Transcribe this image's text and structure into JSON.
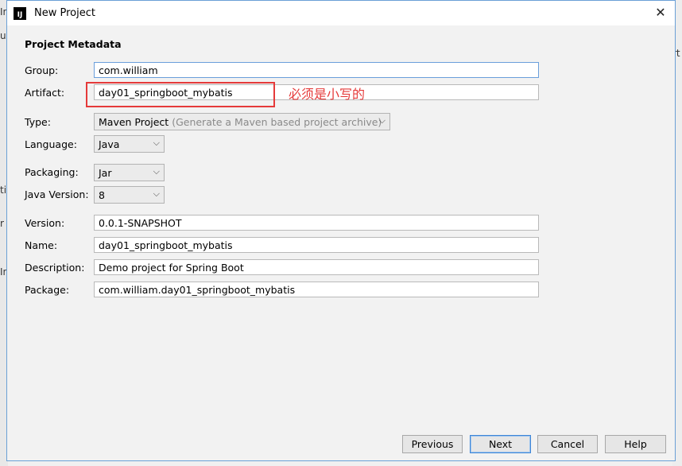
{
  "window": {
    "title": "New Project",
    "app_icon_text": "IJ"
  },
  "background_fragments": {
    "left_top": "In",
    "left_mid": "ur",
    "left_t": "ti",
    "left_r": "r",
    "left_i": "In",
    "right_t": "rt"
  },
  "form": {
    "section_title": "Project Metadata",
    "group": {
      "label": "Group:",
      "value": "com.william"
    },
    "artifact": {
      "label": "Artifact:",
      "value": "day01_springboot_mybatis"
    },
    "type": {
      "label": "Type:",
      "value": "Maven Project",
      "hint": "(Generate a Maven based project archive)"
    },
    "language": {
      "label": "Language:",
      "value": "Java"
    },
    "packaging": {
      "label": "Packaging:",
      "value": "Jar"
    },
    "java_version": {
      "label": "Java Version:",
      "value": "8"
    },
    "version": {
      "label": "Version:",
      "value": "0.0.1-SNAPSHOT"
    },
    "name": {
      "label": "Name:",
      "value": "day01_springboot_mybatis"
    },
    "description": {
      "label": "Description:",
      "value": "Demo project for Spring Boot"
    },
    "package": {
      "label": "Package:",
      "value": "com.william.day01_springboot_mybatis"
    }
  },
  "annotation": {
    "text": "必须是小写的",
    "color": "#e53a3a"
  },
  "buttons": {
    "previous": "Previous",
    "next": "Next",
    "cancel": "Cancel",
    "help": "Help"
  },
  "colors": {
    "accent": "#3f86d6",
    "annotation": "#e53a3a"
  }
}
